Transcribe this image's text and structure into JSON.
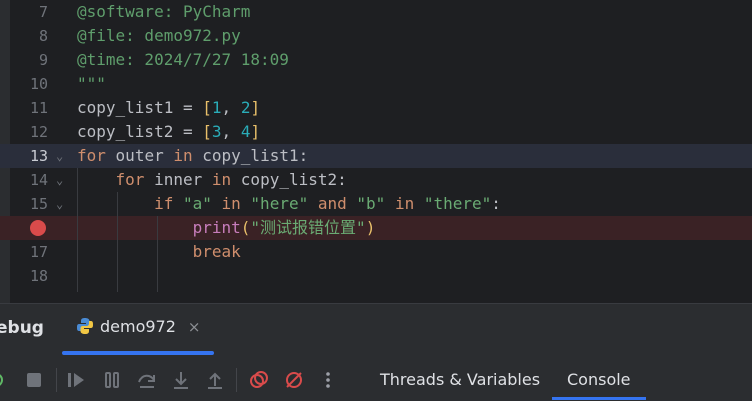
{
  "editor": {
    "lines": [
      {
        "num": "7",
        "text": "@software: PyCharm"
      },
      {
        "num": "8",
        "text": "@file: demo972.py"
      },
      {
        "num": "9",
        "text": "@time: 2024/7/27 18:09"
      },
      {
        "num": "10",
        "text": "\"\"\""
      },
      {
        "num": "11",
        "text": "copy_list1 = [1, 2]"
      },
      {
        "num": "12",
        "text": "copy_list2 = [3, 4]"
      },
      {
        "num": "13",
        "text": "for outer in copy_list1:"
      },
      {
        "num": "14",
        "text": "    for inner in copy_list2:"
      },
      {
        "num": "15",
        "text": "        if \"a\" in \"here\" and \"b\" in \"there\":"
      },
      {
        "num": "16",
        "text": "            print(\"测试报错位置\")"
      },
      {
        "num": "17",
        "text": "            break"
      },
      {
        "num": "18",
        "text": ""
      }
    ],
    "caret_line": "13",
    "breakpoint_line": "16"
  },
  "debug_panel": {
    "title": "ebug",
    "tab_label": "demo972",
    "tab_close": "×",
    "panel_tabs": [
      "Threads & Variables",
      "Console"
    ],
    "active_panel_tab": "Console"
  },
  "colors": {
    "keyword": "#cf8e6d",
    "number": "#2aacb8",
    "string": "#6aab73",
    "builtin": "#c77dbb",
    "breakpoint": "#d94b4b",
    "accent": "#3574f0"
  },
  "icons": [
    "python-file-icon",
    "close-icon",
    "stop-icon",
    "resume-icon",
    "pause-icon",
    "step-over-icon",
    "step-into-icon",
    "step-out-icon",
    "view-breakpoints-icon",
    "mute-breakpoints-icon",
    "more-icon"
  ]
}
